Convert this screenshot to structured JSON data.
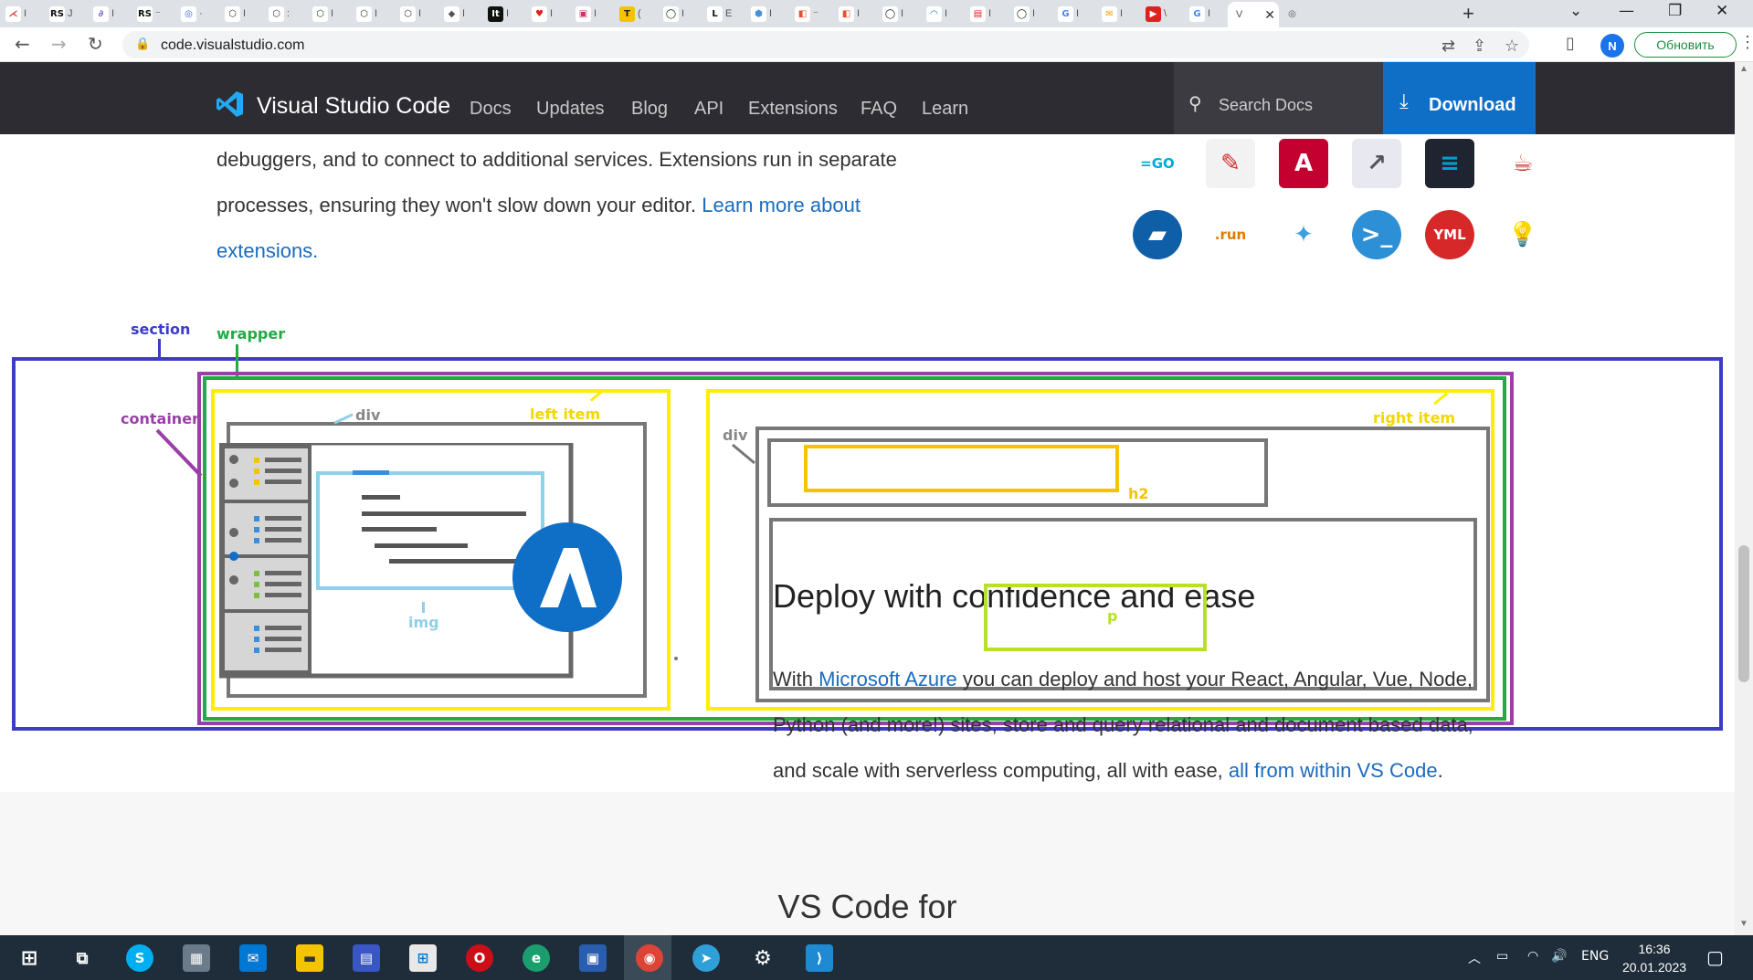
{
  "browser": {
    "tabs": [
      {
        "glyph": "⋌",
        "bg": "#ffffff",
        "fg": "#d62828",
        "text": "I"
      },
      {
        "glyph": "RS",
        "bg": "#ffffff",
        "fg": "#111111",
        "text": "J"
      },
      {
        "glyph": "∂",
        "bg": "#ffffff",
        "fg": "#7b5cd6",
        "text": "I"
      },
      {
        "glyph": "RS",
        "bg": "#ffffff",
        "fg": "#111111",
        "text": "⁻"
      },
      {
        "glyph": "◎",
        "bg": "#ffffff",
        "fg": "#3b5bdb",
        "text": "·"
      },
      {
        "glyph": "⬡",
        "bg": "#ffffff",
        "fg": "#333333",
        "text": "I"
      },
      {
        "glyph": "⬡",
        "bg": "#ffffff",
        "fg": "#333333",
        "text": ":"
      },
      {
        "glyph": "⬡",
        "bg": "#ffffff",
        "fg": "#333333",
        "text": "I"
      },
      {
        "glyph": "⬡",
        "bg": "#ffffff",
        "fg": "#333333",
        "text": "I"
      },
      {
        "glyph": "⬡",
        "bg": "#ffffff",
        "fg": "#333333",
        "text": "I"
      },
      {
        "glyph": "◆",
        "bg": "#ffffff",
        "fg": "#555555",
        "text": "I"
      },
      {
        "glyph": "It",
        "bg": "#111111",
        "fg": "#ffffff",
        "text": "I"
      },
      {
        "glyph": "♥",
        "bg": "#ffffff",
        "fg": "#e02020",
        "text": "I"
      },
      {
        "glyph": "▣",
        "bg": "#ffffff",
        "fg": "#cc3366",
        "text": "I"
      },
      {
        "glyph": "T",
        "bg": "#f5c400",
        "fg": "#222222",
        "text": "("
      },
      {
        "glyph": "◯",
        "bg": "#ffffff",
        "fg": "#111111",
        "text": "I"
      },
      {
        "glyph": "L",
        "bg": "#ffffff",
        "fg": "#111111",
        "text": "E"
      },
      {
        "glyph": "⬢",
        "bg": "#ffffff",
        "fg": "#4a90d9",
        "text": "I"
      },
      {
        "glyph": "◧",
        "bg": "#ffffff",
        "fg": "#e8502c",
        "text": "⁻"
      },
      {
        "glyph": "◧",
        "bg": "#ffffff",
        "fg": "#e8502c",
        "text": "I"
      },
      {
        "glyph": "◯",
        "bg": "#ffffff",
        "fg": "#111111",
        "text": "I"
      },
      {
        "glyph": "◠",
        "bg": "#ffffff",
        "fg": "#1a6bbf",
        "text": "I"
      },
      {
        "glyph": "▤",
        "bg": "#ffffff",
        "fg": "#e02020",
        "text": "I"
      },
      {
        "glyph": "◯",
        "bg": "#ffffff",
        "fg": "#111111",
        "text": "I"
      },
      {
        "glyph": "G",
        "bg": "#ffffff",
        "fg": "#4285f4",
        "text": "I"
      },
      {
        "glyph": "✉",
        "bg": "#ffffff",
        "fg": "#f0a000",
        "text": "I"
      },
      {
        "glyph": "▶",
        "bg": "#e02020",
        "fg": "#ffffff",
        "text": "\\"
      },
      {
        "glyph": "G",
        "bg": "#ffffff",
        "fg": "#4285f4",
        "text": "I"
      }
    ],
    "active_tab": {
      "text": "V",
      "close": "✕"
    },
    "extra_tab": {
      "glyph": "◎"
    },
    "new_tab": "+",
    "url": "code.visualstudio.com",
    "profile_initial": "N",
    "update_label": "Обновить"
  },
  "vscode_nav": {
    "brand": "Visual Studio Code",
    "links": [
      "Docs",
      "Updates",
      "Blog",
      "API",
      "Extensions",
      "FAQ",
      "Learn"
    ],
    "search_placeholder": "Search Docs",
    "download_label": "Download"
  },
  "intro": {
    "line1": "debuggers, and to connect to additional services. Extensions run in separate",
    "line2_plain": "processes, ensuring they won't slow down your editor. ",
    "line2_link": "Learn more about",
    "line3_link": "extensions."
  },
  "extension_icons": [
    {
      "name": "go-extension-icon",
      "text": "=GO",
      "fg": "#00acd7",
      "bg": "transparent"
    },
    {
      "name": "todo-extension-icon",
      "text": "✎",
      "fg": "#d62828",
      "bg": "#f2f2f2"
    },
    {
      "name": "angular-extension-icon",
      "text": "A",
      "fg": "#ffffff",
      "bg": "#c3002f"
    },
    {
      "name": "share-extension-icon",
      "text": "↗",
      "fg": "#555555",
      "bg": "#e8e8f0"
    },
    {
      "name": "code-outline-extension-icon",
      "text": "≡",
      "fg": "#00a0d0",
      "bg": "#1e2430"
    },
    {
      "name": "debugger-extension-icon",
      "text": "☕",
      "fg": "#c0392b",
      "bg": "transparent"
    },
    {
      "name": "folder-extension-icon",
      "text": "▰",
      "fg": "#ffffff",
      "bg": "#0f5fa8"
    },
    {
      "name": "run-extension-icon",
      "text": ".run",
      "fg": "#e07b00",
      "bg": "transparent"
    },
    {
      "name": "kubernetes-extension-icon",
      "text": "✦",
      "fg": "#3aa0e0",
      "bg": "transparent"
    },
    {
      "name": "powershell-extension-icon",
      "text": ">_",
      "fg": "#ffffff",
      "bg": "#2d8fd5"
    },
    {
      "name": "yaml-extension-icon",
      "text": "YML",
      "fg": "#ffffff",
      "bg": "#d62828"
    },
    {
      "name": "lightbulb-extension-icon",
      "text": "💡",
      "fg": "#7a5fa8",
      "bg": "transparent"
    }
  ],
  "annotations": {
    "section": "section",
    "wrapper": "wrapper",
    "container": "container",
    "div_left": "div",
    "left_item": "left item",
    "img": "img",
    "div_right": "div",
    "right_item": "right item",
    "h2": "h2",
    "p": "p"
  },
  "deploy": {
    "heading": "Deploy with confidence and ease",
    "p_prefix": "With ",
    "p_link1": "Microsoft Azure",
    "p_middle": " you can deploy and host your React, Angular, Vue, Node, Python (and more!) sites, store and query relational and document based data, and scale with serverless computing, all with ease, ",
    "p_link2": "all from within VS Code",
    "p_suffix": "."
  },
  "next_section_title": "VS Code for",
  "taskbar": {
    "language": "ENG",
    "time": "16:36",
    "date": "20.01.2023"
  },
  "colors": {
    "section": "#3c3cc8",
    "wrapper": "#22aa44",
    "container": "#9b3fa8",
    "item": "#ffee00",
    "div_box": "#777777",
    "img_box": "#90d0e8",
    "h2_box": "#f5c400",
    "p_box": "#b6e02a",
    "link": "#1a6bbf",
    "azure": "#0f6ec6"
  }
}
